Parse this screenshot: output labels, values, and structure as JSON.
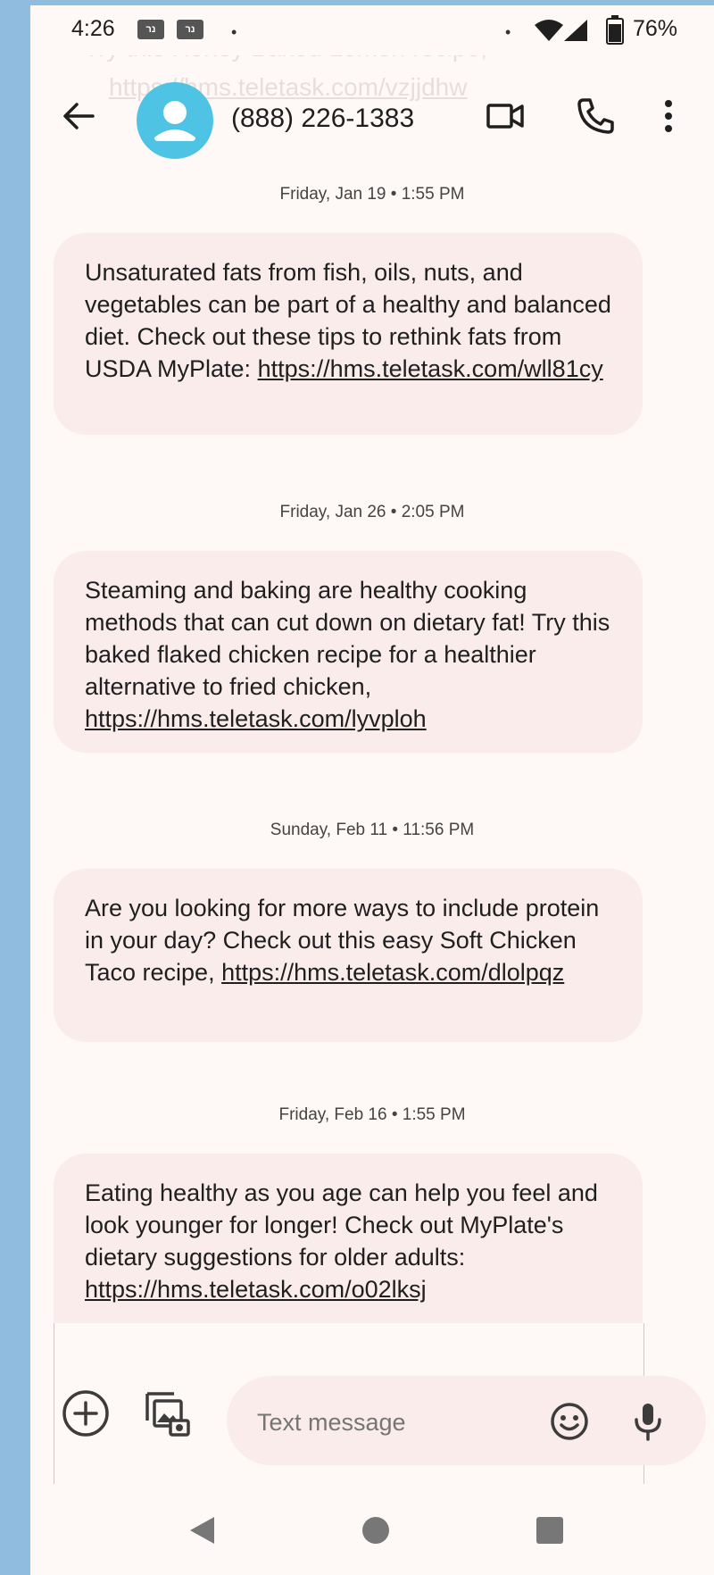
{
  "status_bar": {
    "time": "4:26",
    "notification_icons": [
      "נר",
      "נר"
    ],
    "dot_left": "•",
    "dot_right": "•",
    "battery_percent": "76%"
  },
  "ghost_message": {
    "line1": "Try this Honey Baked Lemon recipe,",
    "line2": "https://hms.teletask.com/vzjjdhw"
  },
  "app_bar": {
    "contact_name": "(888) 226-1383"
  },
  "messages": [
    {
      "timestamp": "Friday, Jan 19 • 1:55 PM",
      "text": "Unsaturated fats from fish, oils, nuts, and vegetables can be part of a healthy and balanced diet. Check out these tips to rethink fats from USDA MyPlate:",
      "link": "https://hms.teletask.com/wll81cy"
    },
    {
      "timestamp": "Friday, Jan 26 • 2:05 PM",
      "text": "Steaming and baking are healthy cooking methods that can cut down on dietary fat! Try this baked flaked chicken recipe for a healthier alternative to fried chicken,",
      "link": "https://hms.teletask.com/lyvploh"
    },
    {
      "timestamp": "Sunday, Feb 11 • 11:56 PM",
      "text": "Are you looking for more ways to include protein in your day? Check out this easy Soft Chicken Taco recipe,",
      "link": "https://hms.teletask.com/dlolpqz"
    },
    {
      "timestamp": "Friday, Feb 16 • 1:55 PM",
      "text": "Eating healthy as you age can help you feel and look younger for longer! Check out MyPlate's dietary suggestions for older adults:",
      "link": "https://hms.teletask.com/o02lksj"
    }
  ],
  "composer": {
    "placeholder": "Text message"
  },
  "colors": {
    "avatar": "#4fc3e3",
    "bubble": "#f9ecea",
    "background": "#fef8f6",
    "side_strip": "#8fbcdf"
  },
  "icons": [
    "back-arrow-icon",
    "contact-avatar-icon",
    "video-call-icon",
    "phone-call-icon",
    "more-vert-icon",
    "add-icon",
    "gallery-icon",
    "emoji-icon",
    "microphone-icon",
    "nav-back-icon",
    "nav-home-icon",
    "nav-recents-icon",
    "wifi-icon",
    "signal-icon",
    "battery-icon"
  ]
}
